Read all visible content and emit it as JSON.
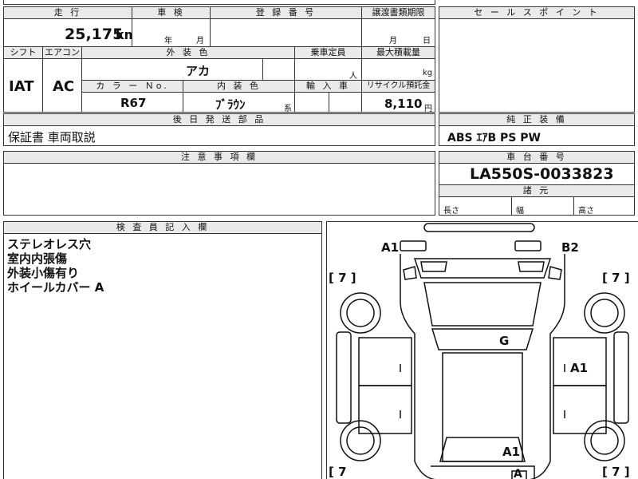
{
  "top": {
    "mileage_label": "走 行",
    "mileage_value": "25,175",
    "mileage_unit": "km",
    "inspection_label": "車 検",
    "inspection_year": "年",
    "inspection_month": "月",
    "registration_label": "登 録 番 号",
    "transfer_label": "譲渡書類期限",
    "transfer_month": "月",
    "transfer_day": "日",
    "salespoint_label": "セ ー ル ス ポ イ ン ト"
  },
  "spec": {
    "shift_label": "シフト",
    "shift_value": "IAT",
    "ac_label": "エアコン",
    "ac_value": "AC",
    "exterior_label": "外 装 色",
    "exterior_value": "アカ",
    "capacity_label": "乗車定員",
    "capacity_unit": "人",
    "load_label": "最大積載量",
    "load_unit": "kg",
    "color_no_label": "カ ラ ー Ｎo.",
    "color_no_value": "R67",
    "interior_label": "内 装 色",
    "interior_value": "ﾌﾞﾗｳﾝ",
    "interior_suffix": "系",
    "import_label": "輸 入 車",
    "recycle_label": "リサイクル預託金",
    "recycle_value": "8,110",
    "recycle_unit": "円"
  },
  "shipping": {
    "label": "後 日 発 送 部 品",
    "value": "保証書 車両取説"
  },
  "equipment": {
    "label": "純 正 装 備",
    "value": "ABS ｴｱB PS PW"
  },
  "notes": {
    "label": "注 意 事 項 欄"
  },
  "chassis": {
    "label": "車 台 番 号",
    "value": "LA550S-0033823",
    "dims_label": "諸 元",
    "length_label": "長さ",
    "width_label": "幅",
    "height_label": "高さ"
  },
  "inspector": {
    "label": "検 査 員 記 入 欄",
    "lines": [
      "ステレオレス穴",
      "室内内張傷",
      "外装小傷有り",
      "ホイールカバー A"
    ]
  },
  "diagram": {
    "marks": {
      "front_left": "A1",
      "front_right": "B2",
      "roof": "G",
      "right_door": "A1",
      "rear": "A1",
      "rear_bottom": "A",
      "tire_fl": "[ 7 ]",
      "tire_fr": "[ 7 ]",
      "tire_rl": "[ 7",
      "tire_rr": "[ 7 ]"
    }
  }
}
